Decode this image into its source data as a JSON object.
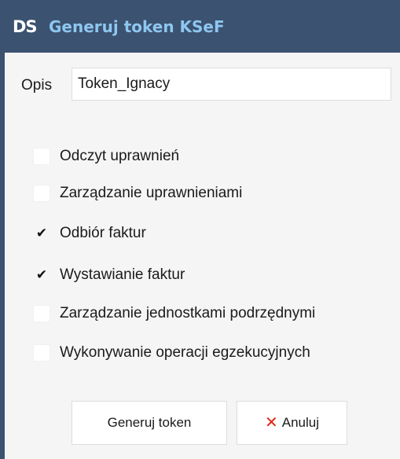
{
  "window": {
    "logo_text": "DS",
    "title": "Generuj token KSeF"
  },
  "form": {
    "description_label": "Opis",
    "description_value": "Token_Ignacy"
  },
  "permissions": [
    {
      "label": "Odczyt uprawnień",
      "checked": false,
      "mark": ""
    },
    {
      "label": "Zarządzanie uprawnieniami",
      "checked": false,
      "mark": ""
    },
    {
      "label": "Odbiór faktur",
      "checked": true,
      "mark": "✔"
    },
    {
      "label": "Wystawianie faktur",
      "checked": true,
      "mark": "✔"
    },
    {
      "label": "Zarządzanie jednostkami podrzędnymi",
      "checked": false,
      "mark": ""
    },
    {
      "label": "Wykonywanie operacji egzekucyjnych",
      "checked": false,
      "mark": ""
    }
  ],
  "buttons": {
    "generate_label": "Generuj token",
    "cancel_icon": "✕",
    "cancel_label": "Anuluj"
  },
  "colors": {
    "titlebar": "#3b5270",
    "title_text": "#8ec6f0",
    "cancel_icon": "#e0261c"
  }
}
